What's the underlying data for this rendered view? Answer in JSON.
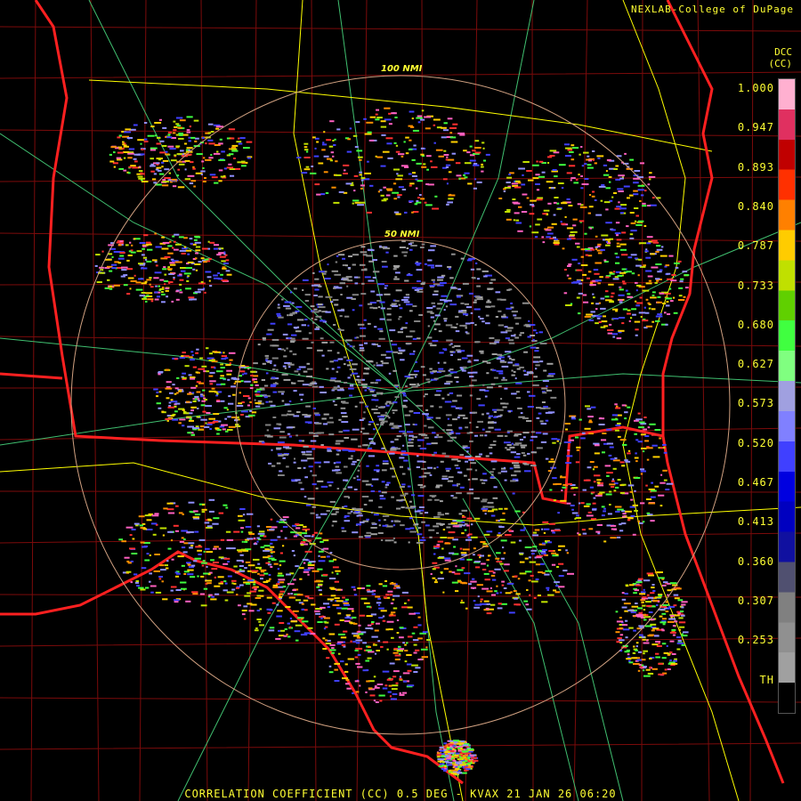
{
  "credit": "NEXLAB-College of DuPage",
  "product": {
    "line1": "DCC",
    "line2": "(CC)"
  },
  "ring_labels": {
    "inner": "50 NMI",
    "outer": "100 NMI"
  },
  "colorbar": {
    "ticks": [
      "1.000",
      "0.947",
      "0.893",
      "0.840",
      "0.787",
      "0.733",
      "0.680",
      "0.627",
      "0.573",
      "0.520",
      "0.467",
      "0.413",
      "0.360",
      "0.307",
      "0.253",
      "TH"
    ],
    "colors": [
      "#ffb0d0",
      "#e03060",
      "#c00000",
      "#ff3000",
      "#ff8000",
      "#ffcc00",
      "#c0e000",
      "#60d000",
      "#40ff40",
      "#80ff80",
      "#a0a0e0",
      "#8080ff",
      "#4040ff",
      "#0000e0",
      "#0000c0",
      "#1010a0",
      "#505070",
      "#808080",
      "#909090",
      "#a0a0a0",
      "#000000"
    ]
  },
  "footer": "CORRELATION COEFFICIENT (CC) 0.5 DEG - KVAX 21 JAN 26 06:20",
  "colors": {
    "state_border": "#ff2020",
    "county": "#b01010",
    "highway": "#ffff00",
    "road": "#40c070",
    "range_ring": "#d0a080"
  }
}
